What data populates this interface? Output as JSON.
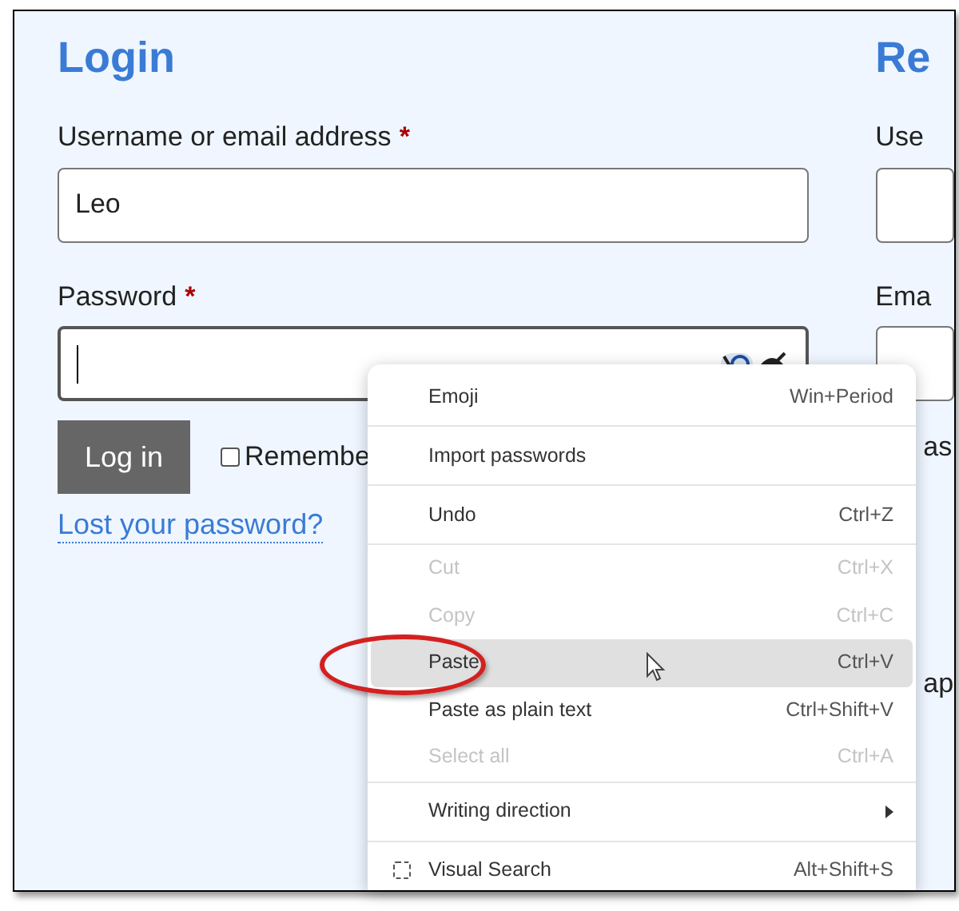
{
  "login": {
    "title": "Login",
    "fields": [
      {
        "label": "Username or email address",
        "required_mark": "*",
        "value": "Leo",
        "focused": false
      },
      {
        "label": "Password",
        "required_mark": "*",
        "focused": true
      }
    ],
    "button": "Log in",
    "remember": {
      "label": "Remembe",
      "checked": false
    },
    "lost_link": "Lost your password?"
  },
  "register": {
    "title": "Re",
    "labels": [
      "Use",
      "Ema"
    ],
    "fragments": [
      "as",
      "ap"
    ]
  },
  "context_menu": {
    "items": [
      {
        "kind": "command",
        "label": "Emoji",
        "shortcut": "Win+Period",
        "disabled": false,
        "selected": false
      },
      {
        "kind": "separator"
      },
      {
        "kind": "command",
        "label": "Import passwords",
        "disabled": false,
        "selected": false
      },
      {
        "kind": "separator"
      },
      {
        "kind": "command",
        "label": "Undo",
        "shortcut": "Ctrl+Z",
        "disabled": false,
        "selected": false
      },
      {
        "kind": "separator"
      },
      {
        "kind": "command",
        "label": "Cut",
        "shortcut": "Ctrl+X",
        "disabled": true,
        "selected": false
      },
      {
        "kind": "command",
        "label": "Copy",
        "shortcut": "Ctrl+C",
        "disabled": true,
        "selected": false
      },
      {
        "kind": "command",
        "label": "Paste",
        "shortcut": "Ctrl+V",
        "disabled": false,
        "selected": true
      },
      {
        "kind": "command",
        "label": "Paste as plain text",
        "shortcut": "Ctrl+Shift+V",
        "disabled": false,
        "selected": false
      },
      {
        "kind": "command",
        "label": "Select all",
        "shortcut": "Ctrl+A",
        "disabled": true,
        "selected": false
      },
      {
        "kind": "separator"
      },
      {
        "kind": "submenu",
        "label": "Writing direction",
        "disabled": false,
        "selected": false
      },
      {
        "kind": "separator"
      },
      {
        "kind": "search",
        "label": "Visual Search",
        "shortcut": "Alt+Shift+S",
        "disabled": false,
        "selected": false
      }
    ]
  }
}
